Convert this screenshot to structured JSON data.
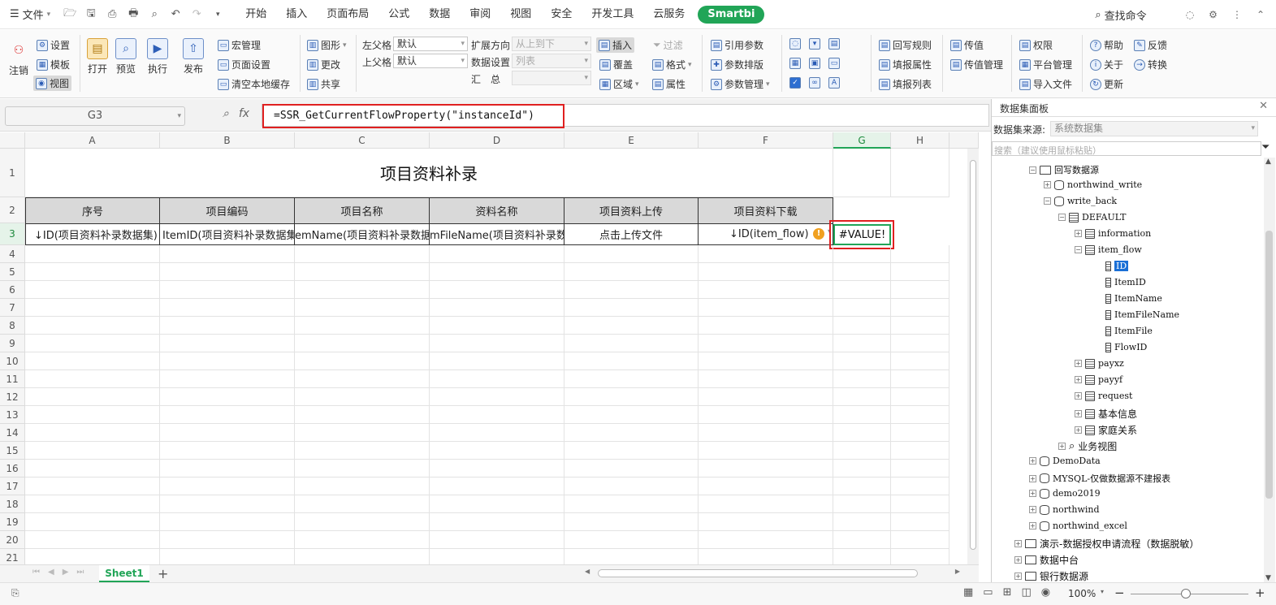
{
  "menu": {
    "file": "文件",
    "tabs": [
      "开始",
      "插入",
      "页面布局",
      "公式",
      "数据",
      "审阅",
      "视图",
      "安全",
      "开发工具",
      "云服务"
    ],
    "smartbi": "Smartbi",
    "search_command": "查找命令"
  },
  "ribbon": {
    "logout": "注销",
    "settings": "设置",
    "template": "模板",
    "view": "视图",
    "open": "打开",
    "preview": "预览",
    "execute": "执行",
    "publish": "发布",
    "macro": "宏管理",
    "page_setup": "页面设置",
    "clear_cache": "清空本地缓存",
    "chart": "图形",
    "modify": "更改",
    "share": "共享",
    "left_parent": "左父格",
    "left_parent_val": "默认",
    "top_parent": "上父格",
    "top_parent_val": "默认",
    "expand_dir": "扩展方向",
    "expand_dir_val": "从上到下",
    "data_settings": "数据设置",
    "data_settings_val": "列表",
    "summary": "汇　总",
    "insert": "插入",
    "filter": "过滤",
    "cover": "覆盖",
    "format": "格式",
    "area": "区域",
    "property": "属性",
    "ref_param": "引用参数",
    "param_layout": "参数排版",
    "param_manage": "参数管理",
    "writeback_rule": "回写规则",
    "fill_property": "填报属性",
    "fill_list": "填报列表",
    "pass_value": "传值",
    "pass_value_manage": "传值管理",
    "permission": "权限",
    "platform_manage": "平台管理",
    "import_file": "导入文件",
    "help": "帮助",
    "about": "关于",
    "update": "更新",
    "feedback": "反馈",
    "convert": "转换"
  },
  "formula_bar": {
    "name_box": "G3",
    "fx": "fx",
    "formula": "=SSR_GetCurrentFlowProperty(\"instanceId\")"
  },
  "sheet": {
    "columns": [
      "A",
      "B",
      "C",
      "D",
      "E",
      "F",
      "G",
      "H"
    ],
    "rows": [
      "1",
      "2",
      "3",
      "4",
      "5",
      "6",
      "7",
      "8",
      "9",
      "10",
      "11",
      "12",
      "13",
      "14",
      "15",
      "16",
      "17",
      "18",
      "19",
      "20",
      "21"
    ],
    "title": "项目资料补录",
    "headers": [
      "序号",
      "项目编码",
      "项目名称",
      "资料名称",
      "项目资料上传",
      "项目资料下载"
    ],
    "row3": [
      "↓ID(项目资料补录数据集)",
      "ItemID(项目资料补录数据集",
      "emName(项目资料补录数据",
      "mFileName(项目资料补录数据",
      "点击上传文件",
      "↓ID(item_flow)",
      "#VALUE!"
    ],
    "active_tab": "Sheet1"
  },
  "panel": {
    "title": "数据集面板",
    "source_label": "数据集来源:",
    "source_value": "系统数据集",
    "search_placeholder": "搜索（建议使用鼠标粘贴）",
    "tree": {
      "writeback_ds": "回写数据源",
      "northwind_write": "northwind_write",
      "write_back": "write_back",
      "default": "DEFAULT",
      "information": "information",
      "item_flow": "item_flow",
      "fields": [
        "ID",
        "ItemID",
        "ItemName",
        "ItemFileName",
        "ItemFile",
        "FlowID"
      ],
      "payxz": "payxz",
      "payyf": "payyf",
      "request": "request",
      "basic_info": "基本信息",
      "family": "家庭关系",
      "biz_view": "业务视图",
      "demodata": "DemoData",
      "mysql": "MYSQL-仅做数据源不建报表",
      "demo2019": "demo2019",
      "northwind": "northwind",
      "northwind_excel": "northwind_excel",
      "demo_flow": "演示-数据授权申请流程（数据脱敏）",
      "data_center": "数据中台",
      "bank": "银行数据源"
    }
  },
  "status": {
    "zoom": "100%"
  }
}
